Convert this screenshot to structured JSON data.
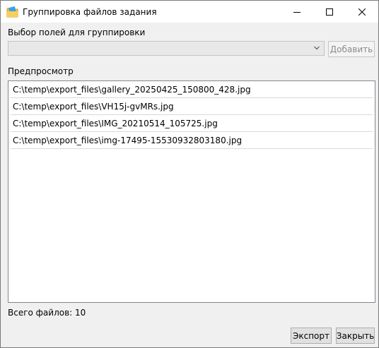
{
  "window": {
    "title": "Группировка файлов задания",
    "icon": "folder-icon"
  },
  "grouping": {
    "label": "Выбор полей для группировки",
    "combo_value": "",
    "add_label": "Добавить"
  },
  "preview": {
    "label": "Предпросмотр",
    "items": [
      "C:\\temp\\export_files\\gallery_20250425_150800_428.jpg",
      "C:\\temp\\export_files\\VH15j-gvMRs.jpg",
      "C:\\temp\\export_files\\IMG_20210514_105725.jpg",
      "C:\\temp\\export_files\\img-17495-15530932803180.jpg"
    ]
  },
  "footer": {
    "total_files": "Всего файлов: 10",
    "export_label": "Экспорт",
    "close_label": "Закрыть"
  }
}
